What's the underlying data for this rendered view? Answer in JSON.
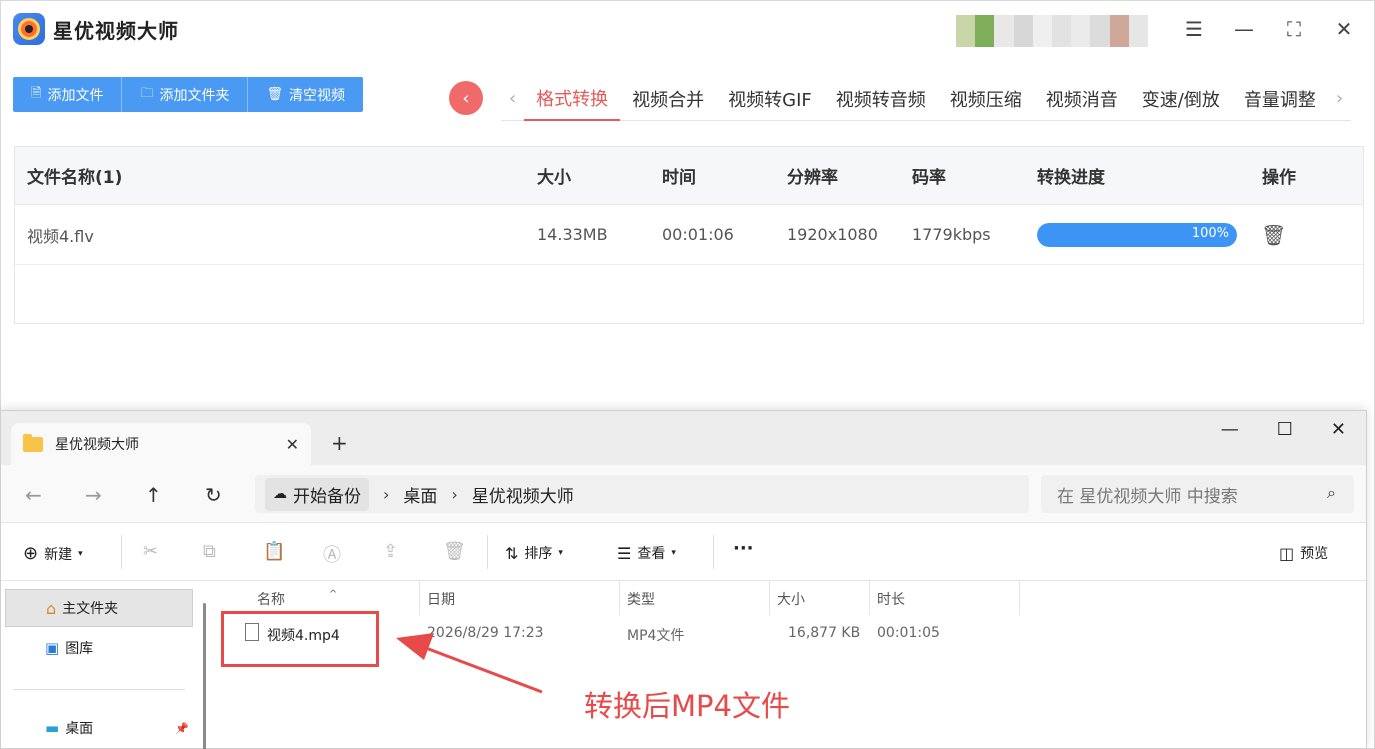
{
  "app": {
    "name": "星优视频大师",
    "toolbar": {
      "add_file": "添加文件",
      "add_folder": "添加文件夹",
      "clear": "清空视频"
    },
    "tabs": [
      "格式转换",
      "视频合并",
      "视频转GIF",
      "视频转音频",
      "视频压缩",
      "视频消音",
      "变速/倒放",
      "音量调整"
    ],
    "active_tab": "格式转换",
    "table": {
      "headers": [
        "文件名称(1)",
        "大小",
        "时间",
        "分辨率",
        "码率",
        "转换进度",
        "操作"
      ],
      "rows": [
        {
          "name": "视频4.flv",
          "size": "14.33MB",
          "time": "00:01:06",
          "resolution": "1920x1080",
          "bitrate": "1779kbps",
          "progress": 100,
          "progress_label": "100%"
        }
      ]
    },
    "colors": {
      "accent": "#e85a5a",
      "primary": "#4a9af4",
      "progress": "#3c95f5"
    }
  },
  "explorer": {
    "tab_title": "星优视频大师",
    "breadcrumb": [
      "开始备份",
      "桌面",
      "星优视频大师"
    ],
    "search_placeholder": "在 星优视频大师 中搜索",
    "toolbar": {
      "new": "新建",
      "sort": "排序",
      "view": "查看",
      "more": "···",
      "preview": "预览"
    },
    "sidebar": [
      {
        "label": "主文件夹",
        "icon": "home-icon",
        "selected": true
      },
      {
        "label": "图库",
        "icon": "gallery-icon",
        "selected": false
      },
      {
        "label": "桌面",
        "icon": "desktop-icon",
        "selected": false,
        "pinned": true
      }
    ],
    "columns": [
      "名称",
      "日期",
      "类型",
      "大小",
      "时长"
    ],
    "files": [
      {
        "name": "视频4.mp4",
        "date": "2026/8/29 17:23",
        "type": "MP4文件",
        "size": "16,877 KB",
        "duration": "00:01:05"
      }
    ]
  },
  "annotation": {
    "text": "转换后MP4文件",
    "color": "#e84a4a"
  }
}
